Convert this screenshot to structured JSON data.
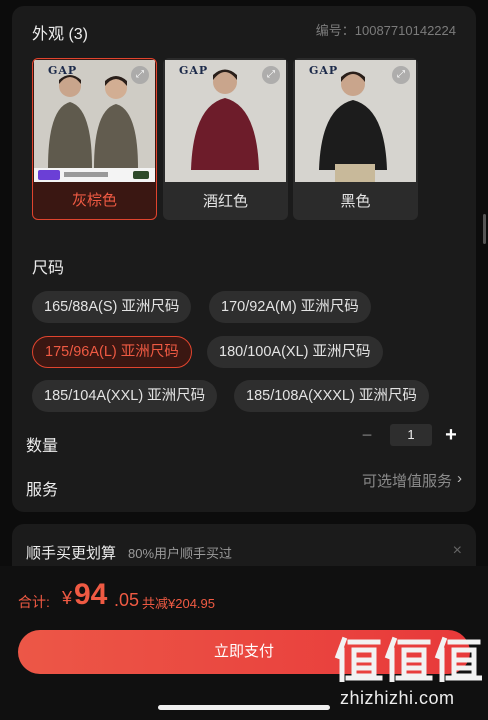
{
  "appearance": {
    "title": "外观 (3)",
    "serial": "编号：10087710142224",
    "colors": [
      {
        "label": "灰棕色",
        "selected": true,
        "shirt": "#5f5a4d",
        "logo": "GAP"
      },
      {
        "label": "酒红色",
        "selected": false,
        "shirt": "#6d1c2a",
        "logo": "GAP"
      },
      {
        "label": "黑色",
        "selected": false,
        "shirt": "#1c1c1c",
        "logo": "GAP"
      }
    ]
  },
  "size": {
    "title": "尺码",
    "options": [
      {
        "label": "165/88A(S) 亚洲尺码",
        "selected": false
      },
      {
        "label": "170/92A(M) 亚洲尺码",
        "selected": false
      },
      {
        "label": "175/96A(L) 亚洲尺码",
        "selected": true
      },
      {
        "label": "180/100A(XL) 亚洲尺码",
        "selected": false
      },
      {
        "label": "185/104A(XXL) 亚洲尺码",
        "selected": false
      },
      {
        "label": "185/108A(XXXL) 亚洲尺码",
        "selected": false
      }
    ]
  },
  "quantity": {
    "label": "数量",
    "value": "1",
    "minus": "−",
    "plus": "+"
  },
  "service": {
    "label": "服务",
    "value": "可选增值服务",
    "chevron": "›"
  },
  "addon": {
    "title": "顺手买更划算",
    "subtitle": "80%用户顺手买过",
    "close": "×"
  },
  "total": {
    "label": "合计:",
    "currency": "¥",
    "integer": "94",
    "decimal": ".05",
    "saving": "共减¥204.95"
  },
  "pay_button": "立即支付",
  "watermark": {
    "logo": "值值值",
    "url": "zhizhizhi.com"
  },
  "colors": {
    "accent": "#e8442f",
    "background": "#0c0c0c",
    "card": "#1b1b1b"
  }
}
